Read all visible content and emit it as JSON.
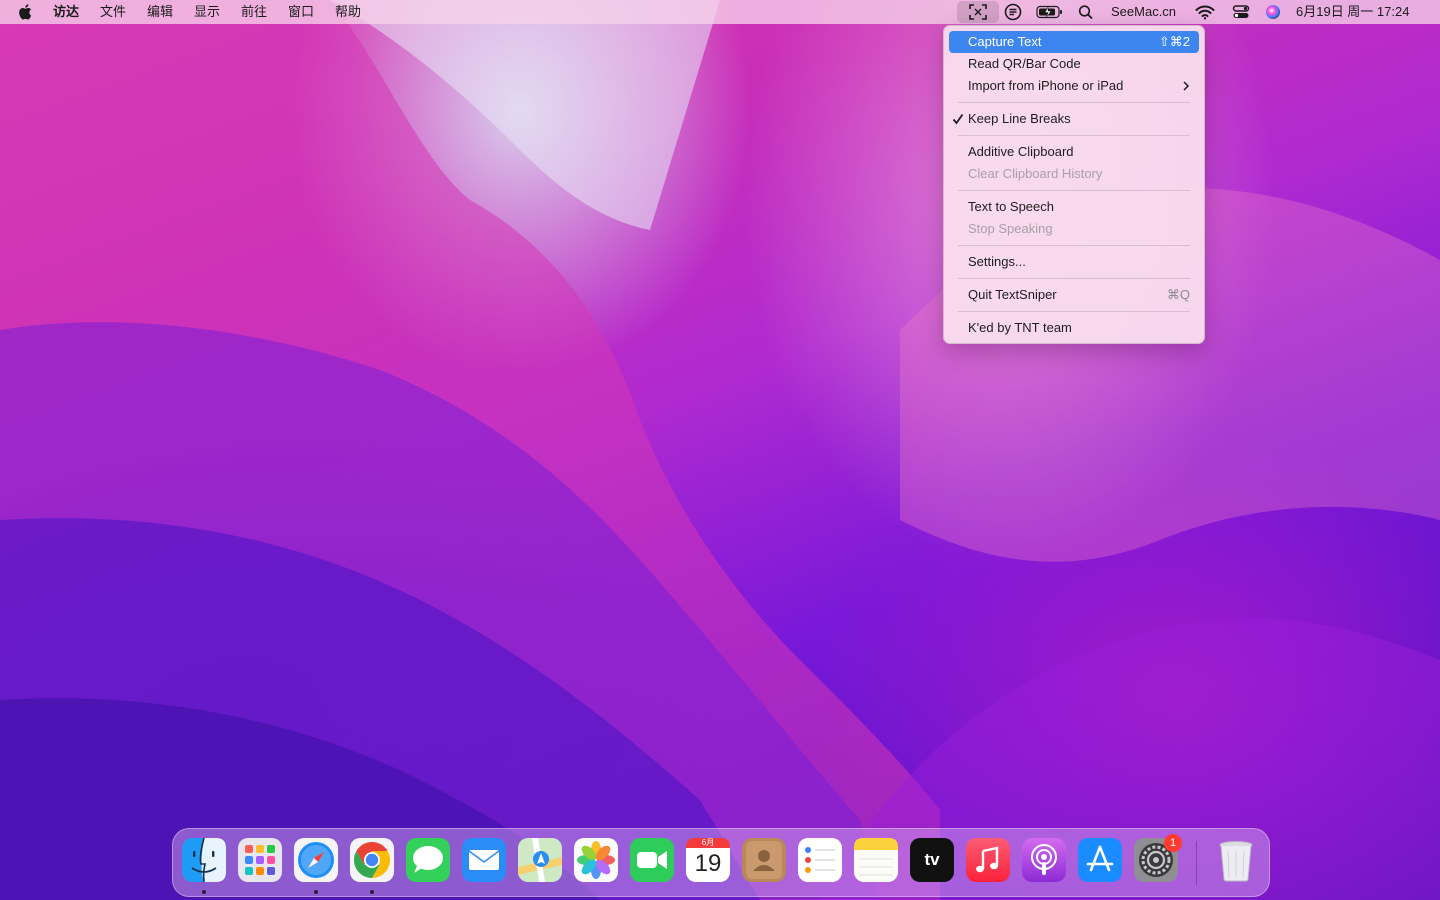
{
  "menubar": {
    "app_name": "访达",
    "menus": [
      "文件",
      "编辑",
      "显示",
      "前往",
      "窗口",
      "帮助"
    ],
    "site_label": "SeeMac.cn",
    "datetime": "6月19日 周一  17:24",
    "status_icons": [
      "textsniper-icon",
      "clipboard-icon",
      "battery-icon",
      "search-icon",
      "wifi-icon",
      "control-center-icon",
      "siri-icon"
    ]
  },
  "menu": {
    "items": [
      {
        "label": "Capture Text",
        "shortcut": "⇧⌘2",
        "highlighted": true
      },
      {
        "label": "Read QR/Bar Code"
      },
      {
        "label": "Import from iPhone or iPad",
        "submenu": true
      },
      {
        "label": "Keep Line Breaks",
        "checked": true
      },
      {
        "label": "Additive Clipboard"
      },
      {
        "label": "Clear Clipboard History",
        "disabled": true
      },
      {
        "label": "Text to Speech"
      },
      {
        "label": "Stop Speaking",
        "disabled": true
      },
      {
        "label": "Settings..."
      },
      {
        "label": "Quit TextSniper",
        "shortcut": "⌘Q"
      },
      {
        "label": "K'ed by TNT team"
      }
    ]
  },
  "dock": {
    "apps": [
      "finder-icon",
      "launchpad-icon",
      "safari-icon",
      "chrome-icon",
      "messages-icon",
      "mail-icon",
      "maps-icon",
      "photos-icon",
      "facetime-icon",
      "calendar-icon",
      "contacts-icon",
      "reminders-icon",
      "notes-icon",
      "apple-tv-icon",
      "music-icon",
      "podcasts-icon",
      "app-store-icon",
      "system-settings-icon",
      "trash-icon"
    ],
    "running": [
      "finder-icon",
      "safari-icon",
      "chrome-icon"
    ],
    "calendar_month": "6月",
    "calendar_day": "19",
    "tv_label": "tv",
    "settings_badge": "1"
  },
  "colors": {
    "menu_highlight": "#3d86f0",
    "badge": "#ff3b30"
  }
}
